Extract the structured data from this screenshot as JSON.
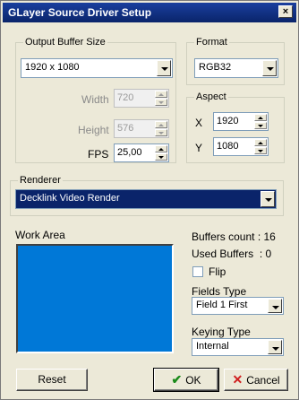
{
  "window": {
    "title": "GLayer Source Driver Setup",
    "close_label": "×"
  },
  "output_buffer": {
    "legend": "Output Buffer Size",
    "size_value": "1920 x 1080",
    "width_label": "Width",
    "width_value": "720",
    "height_label": "Height",
    "height_value": "576",
    "fps_label": "FPS",
    "fps_value": "25,00"
  },
  "format": {
    "legend": "Format",
    "value": "RGB32"
  },
  "aspect": {
    "legend": "Aspect",
    "x_label": "X",
    "x_value": "1920",
    "y_label": "Y",
    "y_value": "1080"
  },
  "renderer": {
    "legend": "Renderer",
    "value": "Decklink Video Render"
  },
  "work_area": {
    "label": "Work Area",
    "color": "#0078d7"
  },
  "buffers": {
    "count_text": "Buffers count : 16",
    "used_text": "Used Buffers  : 0"
  },
  "flip": {
    "label": "Flip",
    "checked": false
  },
  "fields_type": {
    "label": "Fields Type",
    "value": "Field 1 First"
  },
  "keying_type": {
    "label": "Keying Type",
    "value": "Internal"
  },
  "buttons": {
    "reset": "Reset",
    "ok": "OK",
    "cancel": "Cancel"
  }
}
